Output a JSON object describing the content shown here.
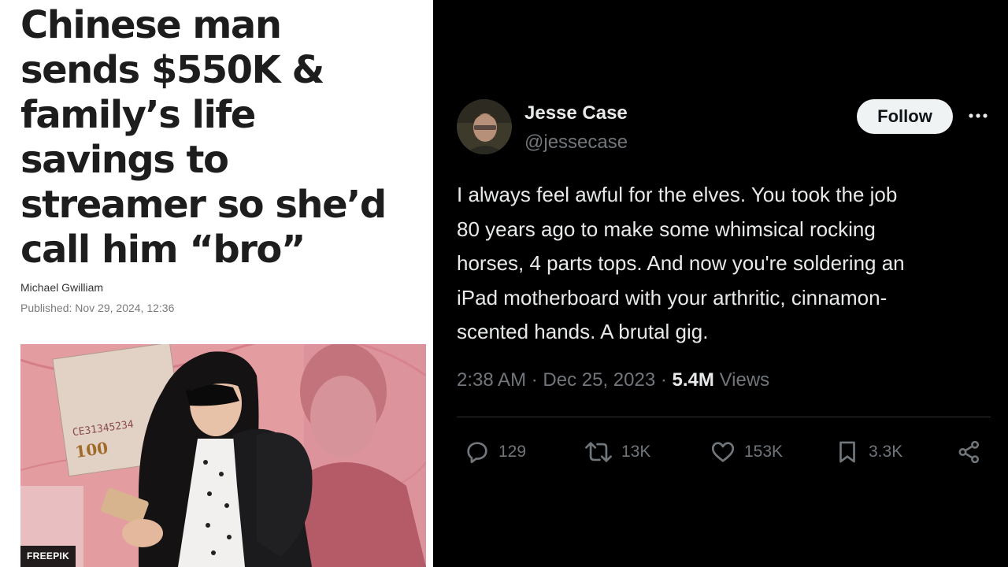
{
  "article": {
    "headline_lines": [
      "Chinese man",
      "sends $550K &",
      "family’s life",
      "savings to",
      "streamer so she’d",
      "call him “bro”"
    ],
    "author": "Michael Gwilliam",
    "published": "Published: Nov 29, 2024, 12:36",
    "image": {
      "credit": "FREEPIK",
      "banknote_serial": "CE31345234",
      "banknote_value": "100"
    }
  },
  "tweet": {
    "display_name": "Jesse Case",
    "handle": "@jessecase",
    "follow_label": "Follow",
    "text_lines": [
      "I always feel awful for the elves. You took the job",
      "80 years ago to make some whimsical rocking",
      "horses, 4 parts tops. And now you're soldering an",
      "iPad motherboard with your arthritic, cinnamon-",
      "scented  hands. A brutal gig."
    ],
    "time": "2:38 AM",
    "date": "Dec 25, 2023",
    "separator": "·",
    "views_count": "5.4M",
    "views_label": "Views",
    "actions": {
      "replies": "129",
      "reposts": "13K",
      "likes": "153K",
      "bookmarks": "3.3K"
    },
    "icons": [
      "reply-icon",
      "repost-icon",
      "like-icon",
      "bookmark-icon",
      "share-icon",
      "more-icon"
    ]
  },
  "colors": {
    "tweet_background": "#000000",
    "tweet_text": "#e7e9ea",
    "tweet_secondary": "#71767b",
    "follow_button": "#eff3f4",
    "article_background": "#ffffff",
    "headline": "#1d1d1d"
  }
}
